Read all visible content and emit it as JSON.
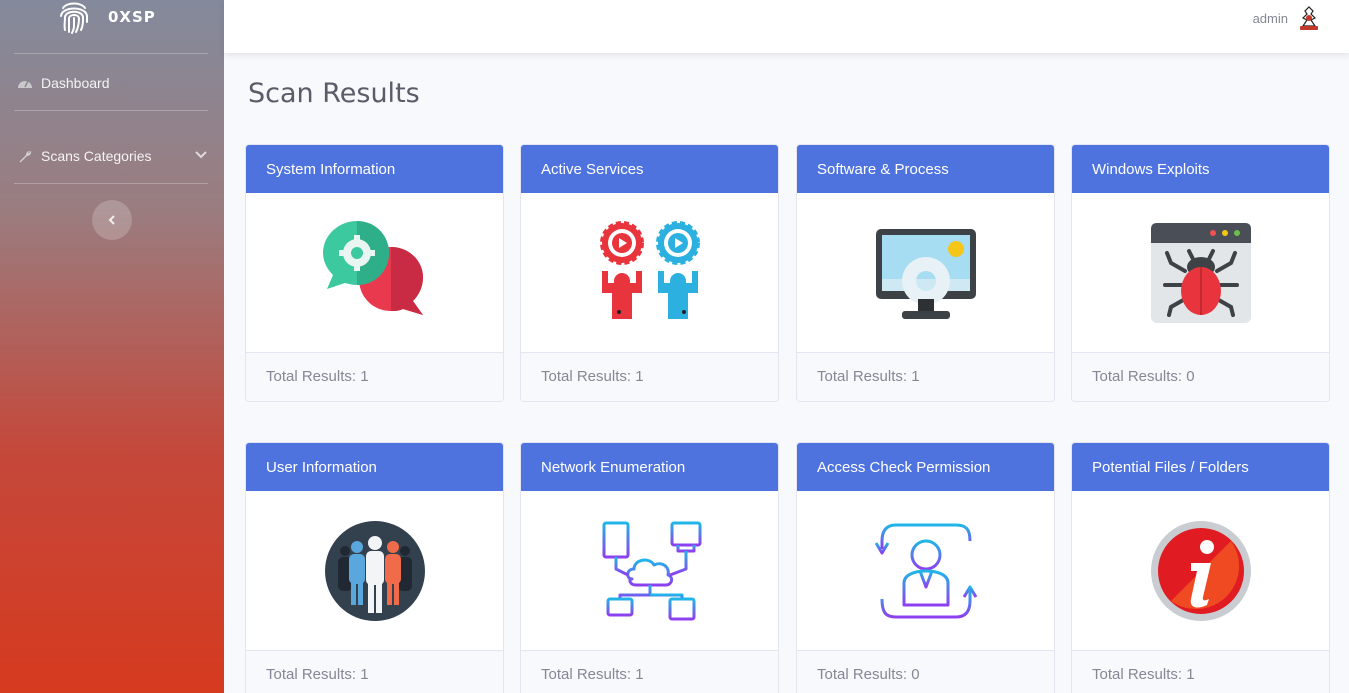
{
  "app": {
    "brand": "0XSP"
  },
  "sidebar": {
    "items": [
      {
        "label": "Dashboard",
        "icon": "gauge-icon"
      },
      {
        "label": "Scans Categories",
        "icon": "wrench-icon"
      }
    ]
  },
  "topbar": {
    "user": "admin"
  },
  "main": {
    "title": "Scan Results",
    "total_label": "Total Results: ",
    "cards": [
      {
        "title": "System Information",
        "count": "1",
        "icon": "chat-gear-icon"
      },
      {
        "title": "Active Services",
        "count": "1",
        "icon": "people-gears-icon"
      },
      {
        "title": "Software & Process",
        "count": "1",
        "icon": "monitor-gear-icon"
      },
      {
        "title": "Windows Exploits",
        "count": "0",
        "icon": "bug-window-icon"
      },
      {
        "title": "User Information",
        "count": "1",
        "icon": "users-group-icon"
      },
      {
        "title": "Network Enumeration",
        "count": "1",
        "icon": "network-cloud-icon"
      },
      {
        "title": "Access Check Permission",
        "count": "0",
        "icon": "user-arrows-icon"
      },
      {
        "title": "Potential Files / Folders",
        "count": "1",
        "icon": "info-icon"
      }
    ]
  },
  "colors": {
    "primary": "#4e73df",
    "sidebar_top": "#848a9c",
    "sidebar_bottom": "#d63a1f"
  }
}
